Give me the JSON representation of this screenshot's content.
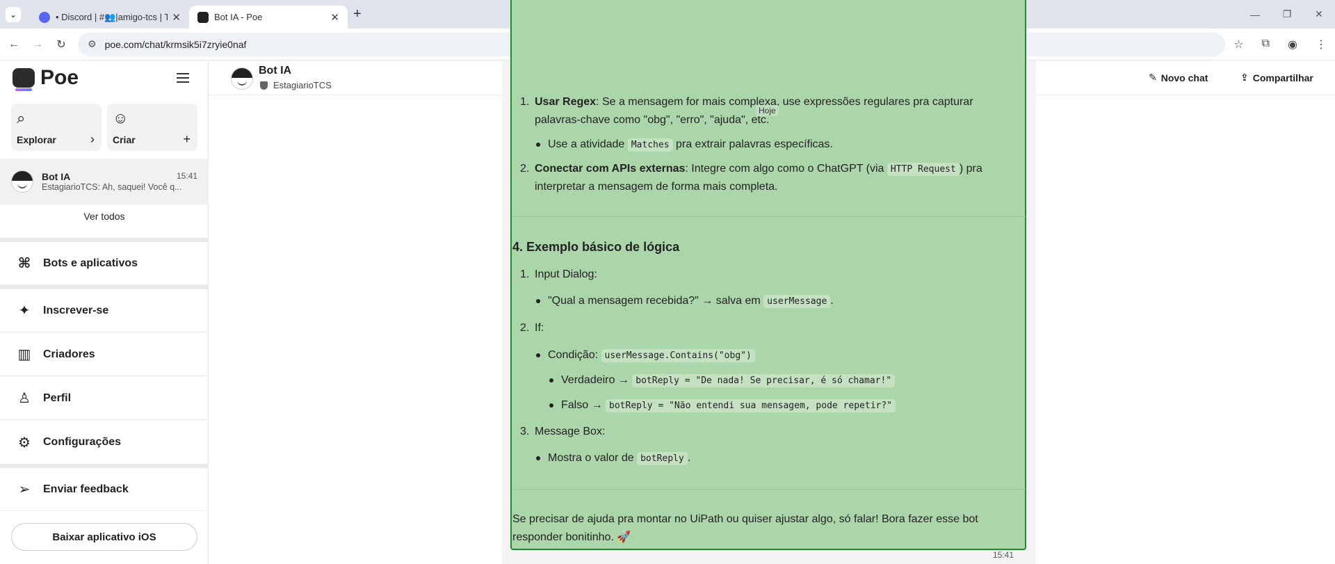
{
  "browser": {
    "tabs": [
      {
        "title": "• Discord | #👥|amigo-tcs | TC",
        "active": false
      },
      {
        "title": "Bot IA - Poe",
        "active": true
      }
    ],
    "url": "poe.com/chat/krmsik5i7zryie0naf"
  },
  "sidebar": {
    "logo": "Poe",
    "explore_label": "Explorar",
    "create_label": "Criar",
    "chat": {
      "name": "Bot IA",
      "time": "15:41",
      "preview": "EstagiarioTCS: Ah, saquei! Você q..."
    },
    "see_all": "Ver todos",
    "menu": [
      {
        "label": "Bots e aplicativos",
        "icon": "bots-grid-icon"
      },
      {
        "label": "Inscrever-se",
        "icon": "subscribe-icon"
      },
      {
        "label": "Criadores",
        "icon": "creators-icon"
      },
      {
        "label": "Perfil",
        "icon": "profile-icon"
      },
      {
        "label": "Configurações",
        "icon": "gear-icon"
      },
      {
        "label": "Enviar feedback",
        "icon": "send-icon"
      }
    ],
    "ios_button": "Baixar aplicativo iOS"
  },
  "header": {
    "bot_name": "Bot IA",
    "owner": "EstagiarioTCS",
    "new_chat": "Novo chat",
    "share": "Compartilhar"
  },
  "message": {
    "tooltip": "Hoje",
    "item1_num": "1.",
    "item1_bold": "Usar Regex",
    "item1_text": ": Se a mensagem for mais complexa, use expressões regulares pra capturar",
    "item1_text2": "palavras-chave como \"obg\", \"erro\", \"ajuda\", etc.",
    "item1_sub_a": "Use a atividade ",
    "item1_sub_code": "Matches",
    "item1_sub_b": " pra extrair palavras específicas.",
    "item2_num": "2.",
    "item2_bold": "Conectar com APIs externas",
    "item2_text": ": Integre com algo como o ChatGPT (via ",
    "item2_code": "HTTP Request",
    "item2_text_b": ") pra",
    "item2_text2": "interpretar a mensagem de forma mais completa.",
    "section_title": "4. Exemplo básico de lógica",
    "s1_num": "1.",
    "s1_label": "Input Dialog:",
    "s1_sub_a": "\"Qual a mensagem recebida?\" → salva em ",
    "s1_sub_code": "userMessage",
    "s1_sub_b": ".",
    "s2_num": "2.",
    "s2_label": "If:",
    "s2_cond_a": "Condição: ",
    "s2_cond_code": "userMessage.Contains(\"obg\")",
    "s2_true_a": "Verdadeiro → ",
    "s2_true_code": "botReply = \"De nada! Se precisar, é só chamar!\"",
    "s2_false_a": "Falso → ",
    "s2_false_code": "botReply = \"Não entendi sua mensagem, pode repetir?\"",
    "s3_num": "3.",
    "s3_label": "Message Box:",
    "s3_sub_a": "Mostra o valor de ",
    "s3_sub_code": "botReply",
    "s3_sub_b": ".",
    "closing_1": "Se precisar de ajuda pra montar no UiPath ou quiser ajustar algo, só falar! Bora fazer esse bot",
    "closing_2": "responder bonitinho. 🚀",
    "time": "15:41"
  }
}
